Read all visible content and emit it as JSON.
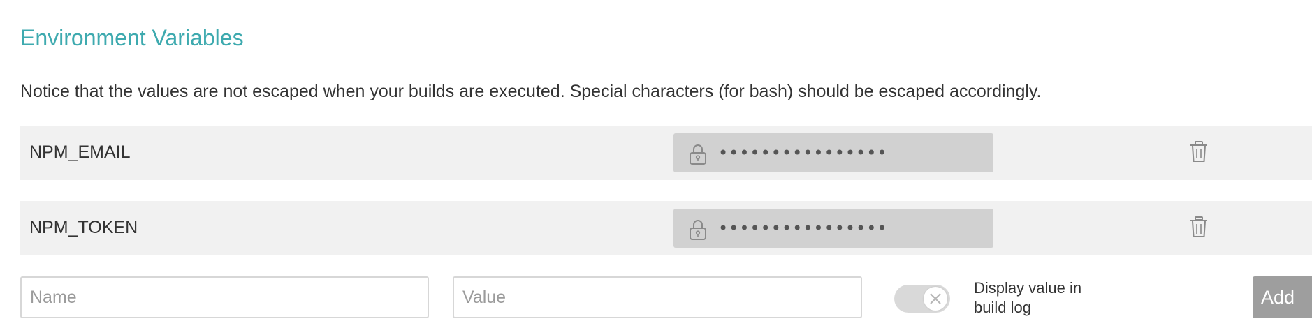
{
  "section": {
    "title": "Environment Variables",
    "notice": "Notice that the values are not escaped when your builds are executed. Special characters (for bash) should be escaped accordingly."
  },
  "variables": [
    {
      "name": "NPM_EMAIL",
      "masked_value": "••••••••••••••••",
      "icon": "lock-icon",
      "delete_icon": "trash-icon"
    },
    {
      "name": "NPM_TOKEN",
      "masked_value": "••••••••••••••••",
      "icon": "lock-icon",
      "delete_icon": "trash-icon"
    }
  ],
  "new_variable": {
    "name_placeholder": "Name",
    "value_placeholder": "Value",
    "display_toggle_label": "Display value in build log",
    "display_toggle_on": false,
    "add_label": "Add"
  },
  "colors": {
    "accent": "#3eaaaf",
    "row_background": "#f1f1f1",
    "masked_field": "#d1d1d1",
    "add_button": "#9e9e9e"
  }
}
